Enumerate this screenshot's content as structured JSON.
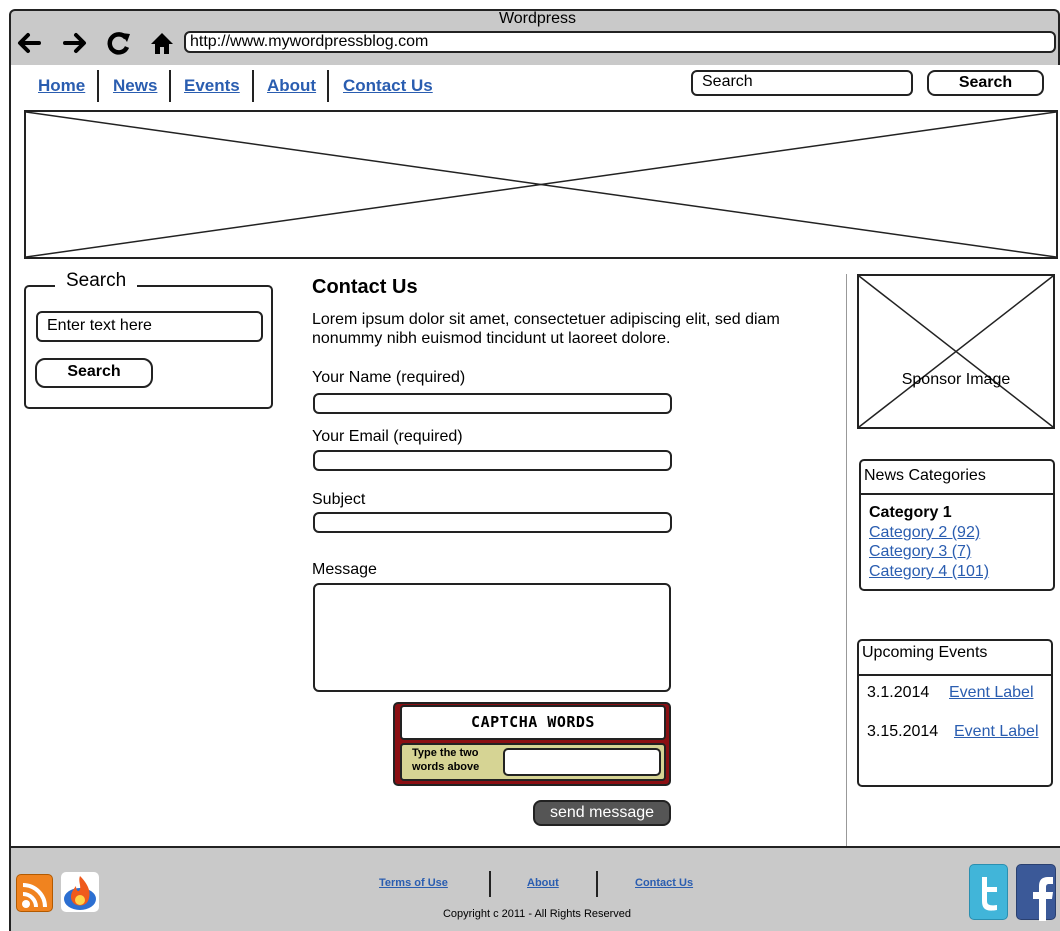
{
  "browser": {
    "window_title": "Wordpress",
    "url": "http://www.mywordpressblog.com"
  },
  "nav": {
    "items": [
      {
        "label": "Home"
      },
      {
        "label": "News"
      },
      {
        "label": "Events"
      },
      {
        "label": "About"
      },
      {
        "label": "Contact Us"
      }
    ],
    "search_value": "Search",
    "search_button": "Search"
  },
  "sidebar": {
    "search_legend": "Search",
    "search_placeholder": "Enter text here",
    "search_button": "Search"
  },
  "main": {
    "title": "Contact Us",
    "intro": "Lorem ipsum dolor sit amet, consectetuer adipiscing elit, sed diam nonummy nibh euismod tincidunt ut laoreet dolore.",
    "fields": {
      "name_label": "Your Name (required)",
      "email_label": "Your Email (required)",
      "subject_label": "Subject",
      "message_label": "Message"
    },
    "captcha": {
      "words": "CAPTCHA WORDS",
      "hint": "Type the two words above"
    },
    "send_button": "send message"
  },
  "right": {
    "sponsor_label": "Sponsor Image",
    "news_categories": {
      "title": "News Categories",
      "active": "Category 1",
      "links": [
        "Category 2 (92)",
        "Category 3 (7)",
        "Category 4 (101)"
      ]
    },
    "events": {
      "title": "Upcoming Events",
      "items": [
        {
          "date": "3.1.2014",
          "label": "Event Label"
        },
        {
          "date": "3.15.2014",
          "label": "Event Label"
        }
      ]
    }
  },
  "footer": {
    "links": [
      "Terms of Use",
      "About",
      "Contact Us"
    ],
    "copyright": "Copyright c 2011 - All Rights Reserved",
    "icons": [
      "rss-icon",
      "feedburner-icon",
      "twitter-icon",
      "facebook-icon"
    ]
  },
  "colors": {
    "chrome_gray": "#c9c9c9",
    "link_blue": "#2a5db0",
    "captcha_red": "#8b0f13",
    "captcha_panel": "#d6d494",
    "rss_orange": "#f0831f",
    "twitter_blue": "#41b5d9",
    "facebook_blue": "#3b5998"
  }
}
